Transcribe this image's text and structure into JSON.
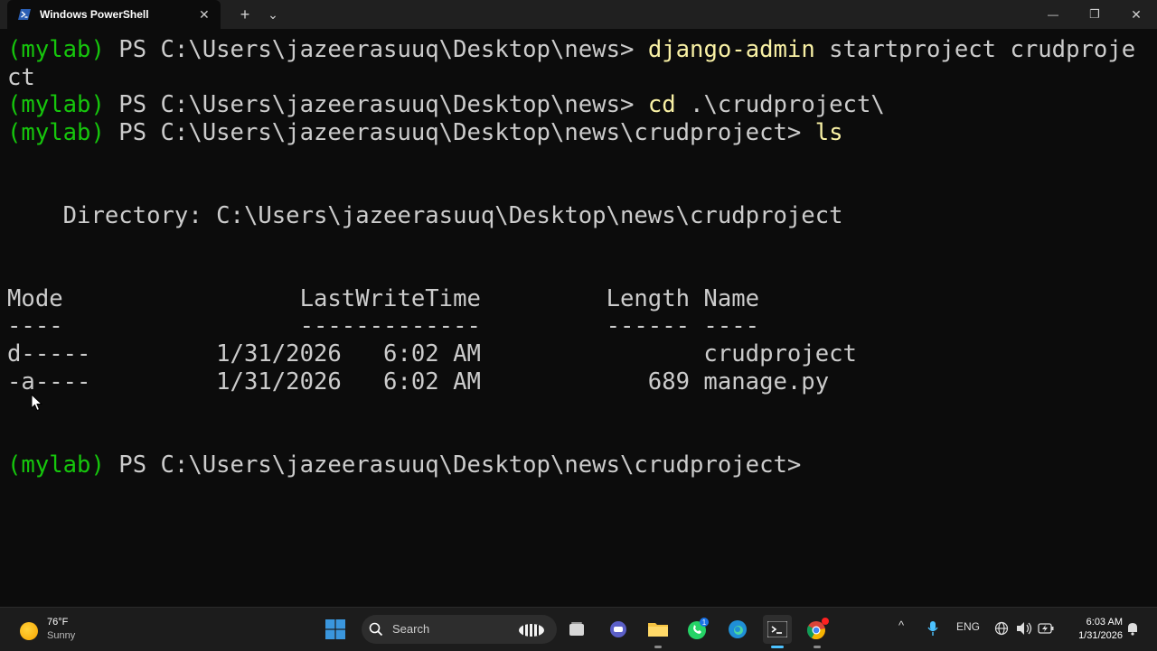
{
  "window": {
    "tab_title": "Windows PowerShell",
    "tab_close": "✕",
    "new_tab": "+",
    "dropdown": "⌄",
    "minimize": "—",
    "maximize": "❐",
    "close": "✕"
  },
  "terminal": {
    "lines": [
      {
        "env": "(mylab)",
        "prompt": " PS C:\\Users\\jazeerasuuq\\Desktop\\news> ",
        "cmd": "django-admin",
        "args": " startproject crudproje"
      },
      {
        "text": "ct"
      },
      {
        "env": "(mylab)",
        "prompt": " PS C:\\Users\\jazeerasuuq\\Desktop\\news> ",
        "cmd": "cd",
        "args": " .\\crudproject\\"
      },
      {
        "env": "(mylab)",
        "prompt": " PS C:\\Users\\jazeerasuuq\\Desktop\\news\\crudproject> ",
        "cmd": "ls",
        "args": ""
      },
      {
        "text": "    Directory: C:\\Users\\jazeerasuuq\\Desktop\\news\\crudproject"
      },
      {
        "text": "Mode                 LastWriteTime         Length Name"
      },
      {
        "text": "----                 -------------         ------ ----"
      },
      {
        "text": "d-----         1/31/2026   6:02 AM                crudproject"
      },
      {
        "text": "-a----         1/31/2026   6:02 AM            689 manage.py"
      },
      {
        "env": "(mylab)",
        "prompt": " PS C:\\Users\\jazeerasuuq\\Desktop\\news\\crudproject>",
        "cmd": "",
        "args": ""
      }
    ]
  },
  "taskbar": {
    "weather_temp": "76°F",
    "weather_cond": "Sunny",
    "search_label": "Search",
    "tray_chevron": "^",
    "language": "ENG",
    "time": "6:03 AM",
    "date": "1/31/2026",
    "whatsapp_badge": "1"
  },
  "colors": {
    "terminal_bg": "#0c0c0c",
    "env_green": "#16c60c",
    "command_yellow": "#f9f1a5",
    "text_gray": "#cccccc",
    "titlebar": "#202020",
    "taskbar": "#1c1c1c"
  }
}
